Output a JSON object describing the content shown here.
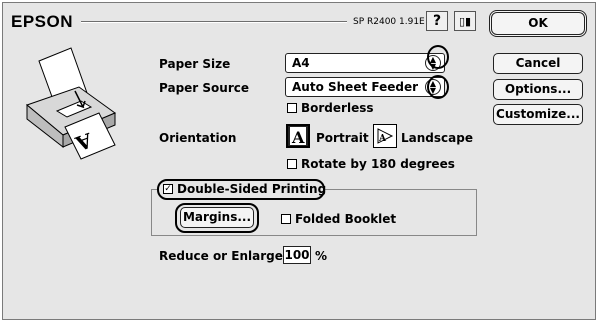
{
  "brand": "EPSON",
  "model": "SP R2400 1.91E",
  "icons": {
    "help": "help-icon",
    "ink": "ink-icon",
    "printer": "printer-illustration-icon"
  },
  "buttons": {
    "ok": "OK",
    "cancel": "Cancel",
    "options": "Options...",
    "customize": "Customize...",
    "margins": "Margins..."
  },
  "paper_size": {
    "label": "Paper Size",
    "value": "A4"
  },
  "paper_source": {
    "label": "Paper Source",
    "value": "Auto Sheet Feeder"
  },
  "borderless": {
    "label": "Borderless",
    "checked": false
  },
  "orientation": {
    "label": "Orientation",
    "portrait": "Portrait",
    "landscape": "Landscape",
    "selected": "Portrait"
  },
  "rotate": {
    "label": "Rotate by 180 degrees",
    "checked": false
  },
  "double_sided": {
    "label": "Double-Sided Printing",
    "checked": true
  },
  "folded_booklet": {
    "label": "Folded Booklet",
    "checked": false
  },
  "reduce": {
    "label": "Reduce or Enlarge",
    "value": "100",
    "unit": "%"
  },
  "colors": {
    "dialog_bg": "#e6e6e6",
    "border": "#222222"
  }
}
